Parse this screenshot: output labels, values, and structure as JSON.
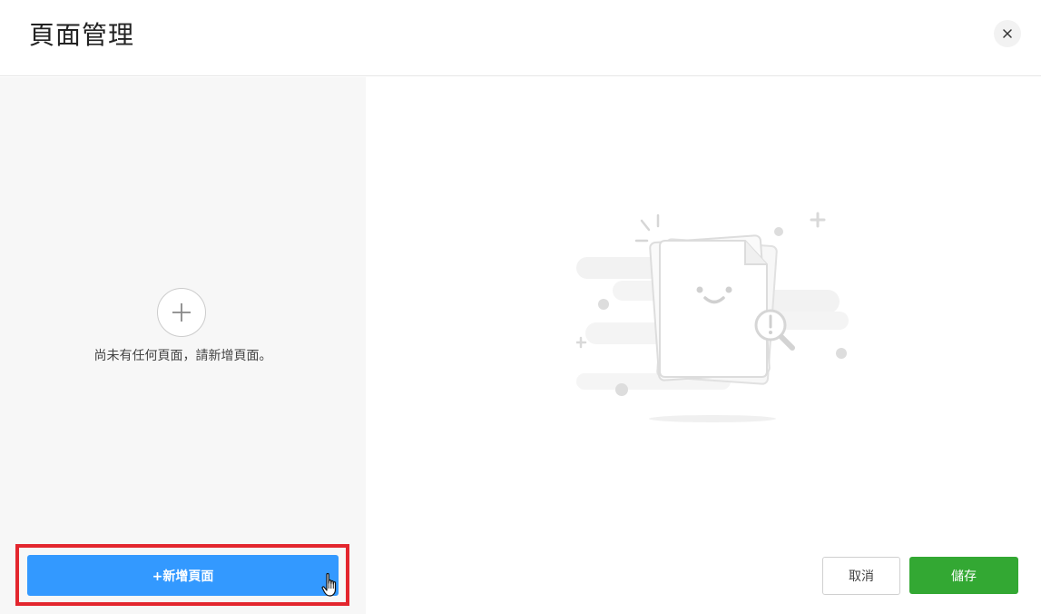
{
  "dialog": {
    "title": "頁面管理",
    "close_icon": "close-icon"
  },
  "sidebar": {
    "empty_add_icon": "plus-icon",
    "empty_message": "尚未有任何頁面，請新增頁面。",
    "add_page_label": "+新增頁面",
    "highlight_color": "#e3262e",
    "cursor_icon": "hand-pointer-icon"
  },
  "main": {
    "illustration": "empty-document-illustration",
    "cancel_label": "取消",
    "save_label": "儲存"
  },
  "colors": {
    "primary_button": "#3399ff",
    "save_button": "#33a833",
    "sidebar_background": "#f7f7f7"
  }
}
